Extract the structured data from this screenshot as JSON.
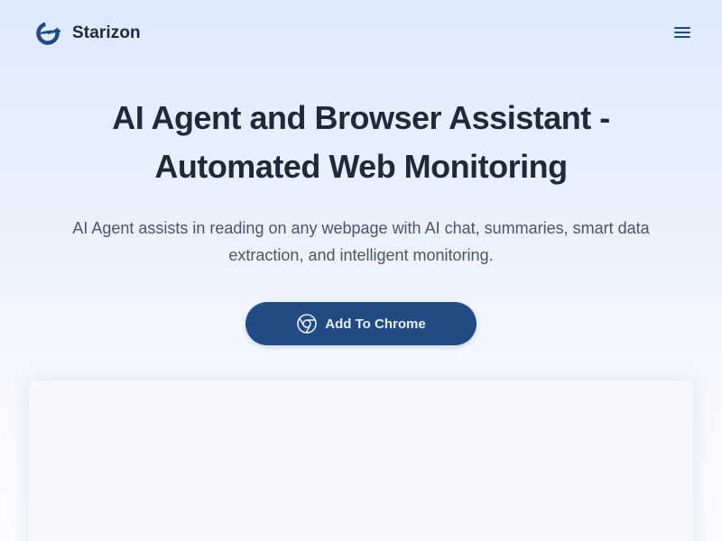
{
  "header": {
    "brand_name": "Starizon",
    "logo_icon": "starizon-logo-icon",
    "menu_icon": "hamburger-menu-icon"
  },
  "hero": {
    "title": "AI Agent and Browser Assistant - Automated Web Monitoring",
    "subtitle": "AI Agent assists in reading on any webpage with AI chat, summaries, smart data extraction, and intelligent monitoring.",
    "cta_label": "Add To Chrome",
    "cta_icon": "chrome-icon"
  },
  "colors": {
    "brand_blue": "#234b83",
    "heading": "#1e2a3a",
    "body_text": "#4b5563",
    "cta_text": "#e7eefb"
  }
}
